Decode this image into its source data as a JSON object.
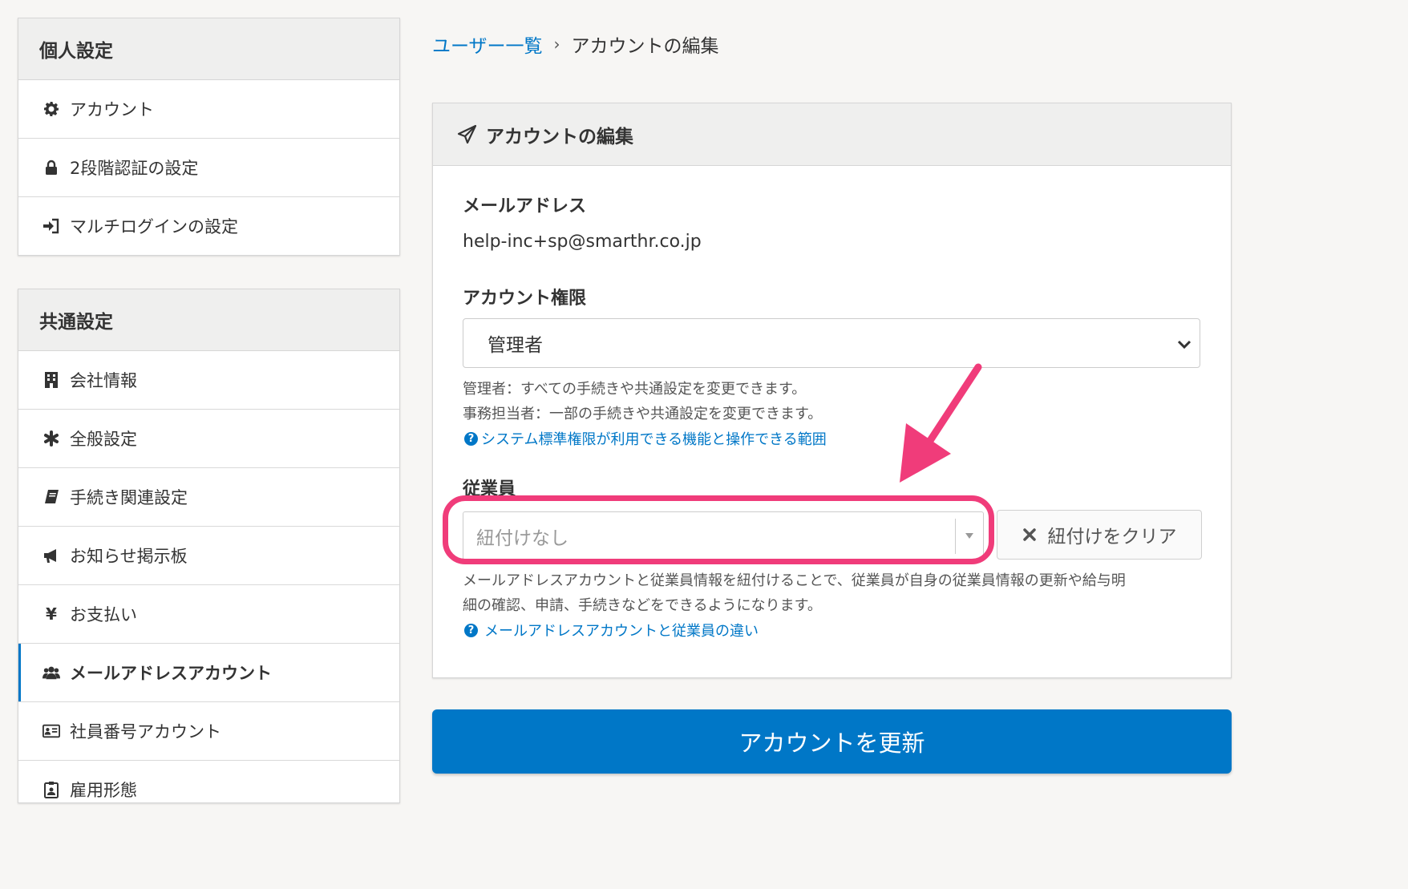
{
  "sidebar": {
    "personal": {
      "title": "個人設定",
      "items": [
        {
          "label": "アカウント",
          "icon": "gear-icon"
        },
        {
          "label": "2段階認証の設定",
          "icon": "lock-icon"
        },
        {
          "label": "マルチログインの設定",
          "icon": "sign-in-icon"
        }
      ]
    },
    "common": {
      "title": "共通設定",
      "items": [
        {
          "label": "会社情報",
          "icon": "building-icon"
        },
        {
          "label": "全般設定",
          "icon": "asterisk-icon"
        },
        {
          "label": "手続き関連設定",
          "icon": "book-icon"
        },
        {
          "label": "お知らせ掲示板",
          "icon": "megaphone-icon"
        },
        {
          "label": "お支払い",
          "icon": "yen-icon"
        },
        {
          "label": "メールアドレスアカウント",
          "icon": "users-icon",
          "active": true
        },
        {
          "label": "社員番号アカウント",
          "icon": "id-card-icon"
        },
        {
          "label": "雇用形態",
          "icon": "badge-icon"
        }
      ]
    }
  },
  "breadcrumb": {
    "link": "ユーザー一覧",
    "separator": "›",
    "current": "アカウントの編集"
  },
  "card": {
    "title": "アカウントの編集",
    "title_icon": "paper-plane-icon",
    "email": {
      "label": "メールアドレス",
      "value": "help-inc+sp@smarthr.co.jp"
    },
    "role": {
      "label": "アカウント権限",
      "selected": "管理者",
      "help_lines": [
        "管理者：すべての手続きや共通設定を変更できます。",
        "事務担当者：一部の手続きや共通設定を変更できます。"
      ],
      "help_link": "システム標準権限が利用できる機能と操作できる範囲"
    },
    "employee": {
      "label": "従業員",
      "placeholder": "紐付けなし",
      "clear_button": "紐付けをクリア",
      "help_lines": [
        "メールアドレスアカウントと従業員情報を紐付けることで、従業員が自身の従業員情報の更新や給与明",
        "細の確認、申請、手続きなどをできるようになります。"
      ],
      "help_link": "メールアドレスアカウントと従業員の違い"
    }
  },
  "submit_button": "アカウントを更新",
  "colors": {
    "accent": "#0077c7",
    "annotation": "#f03c7a"
  }
}
